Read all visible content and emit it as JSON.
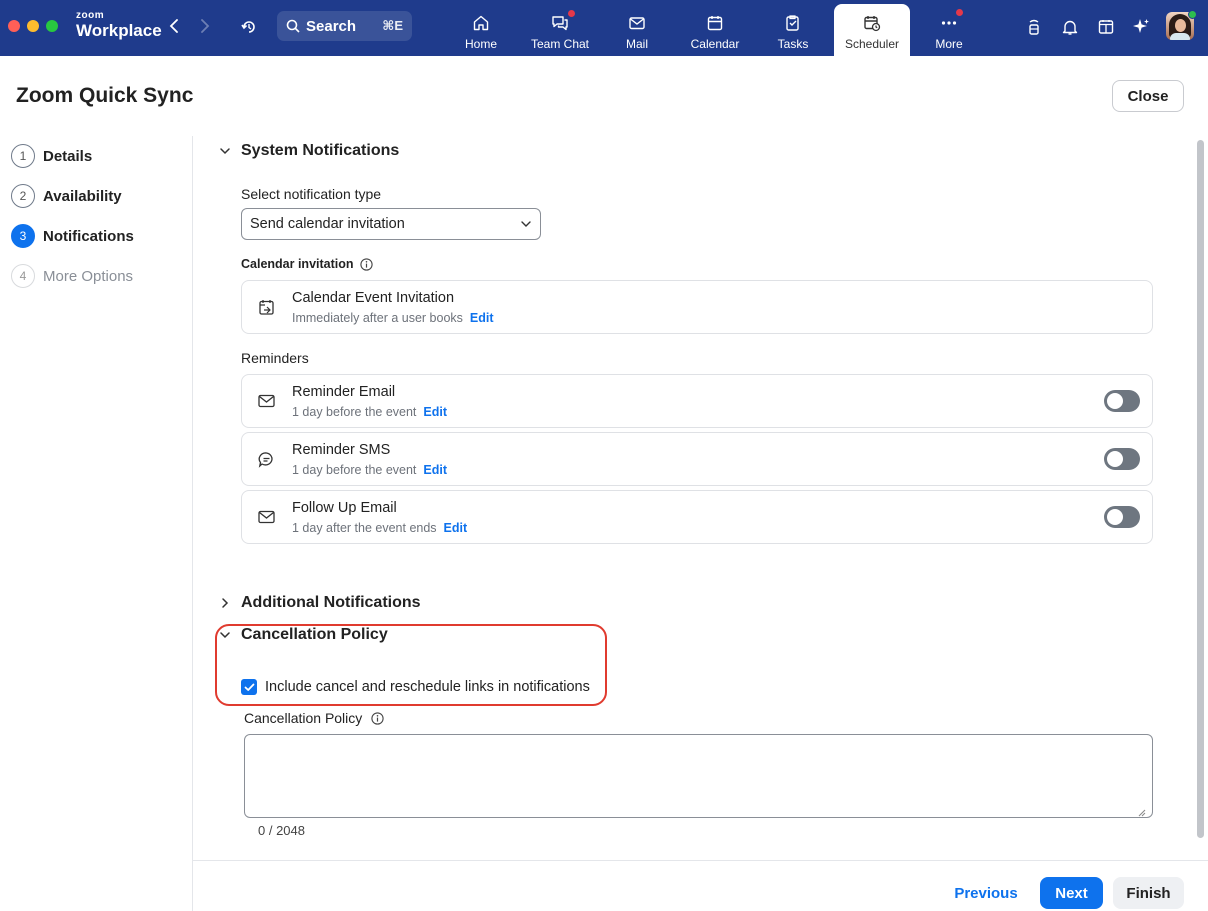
{
  "window": {
    "brand_small": "zoom",
    "brand_name": "Workplace",
    "search": {
      "label": "Search",
      "shortcut": "⌘E"
    }
  },
  "tabs": [
    {
      "label": "Home",
      "icon": "home-icon",
      "badge": false
    },
    {
      "label": "Team Chat",
      "icon": "chat-icon",
      "badge": true
    },
    {
      "label": "Mail",
      "icon": "mail-icon",
      "badge": false
    },
    {
      "label": "Calendar",
      "icon": "calendar-icon",
      "badge": false
    },
    {
      "label": "Tasks",
      "icon": "tasks-icon",
      "badge": false
    },
    {
      "label": "Scheduler",
      "icon": "scheduler-icon",
      "badge": false,
      "active": true
    },
    {
      "label": "More",
      "icon": "more-icon",
      "badge": true
    }
  ],
  "header": {
    "title": "Zoom Quick Sync",
    "close_label": "Close"
  },
  "steps": [
    {
      "number": "1",
      "label": "Details",
      "state": "done"
    },
    {
      "number": "2",
      "label": "Availability",
      "state": "done"
    },
    {
      "number": "3",
      "label": "Notifications",
      "state": "current"
    },
    {
      "number": "4",
      "label": "More Options",
      "state": "disabled"
    }
  ],
  "system_notifications": {
    "title": "System Notifications",
    "select_label": "Select notification type",
    "select_value": "Send calendar invitation",
    "calendar_invitation_heading": "Calendar invitation",
    "calendar_card": {
      "title": "Calendar Event Invitation",
      "subtitle": "Immediately after a user books",
      "edit": "Edit"
    },
    "reminders_heading": "Reminders",
    "reminders": [
      {
        "title": "Reminder Email",
        "subtitle": "1 day before the event",
        "edit": "Edit",
        "icon": "mail-icon",
        "enabled": false
      },
      {
        "title": "Reminder SMS",
        "subtitle": "1 day before the event",
        "edit": "Edit",
        "icon": "sms-icon",
        "enabled": false
      },
      {
        "title": "Follow Up Email",
        "subtitle": "1 day after the event ends",
        "edit": "Edit",
        "icon": "mail-icon",
        "enabled": false
      }
    ]
  },
  "additional_notifications": {
    "title": "Additional Notifications"
  },
  "cancellation_policy": {
    "title": "Cancellation Policy",
    "checkbox_label": "Include cancel and reschedule links in notifications",
    "checkbox_checked": true,
    "textarea_label": "Cancellation Policy",
    "textarea_value": "",
    "counter": "0 / 2048"
  },
  "footer": {
    "previous": "Previous",
    "next": "Next",
    "finish": "Finish"
  },
  "colors": {
    "topbar": "#1f3b8c",
    "accent": "#0e72ed",
    "highlight": "#e03b2f"
  }
}
